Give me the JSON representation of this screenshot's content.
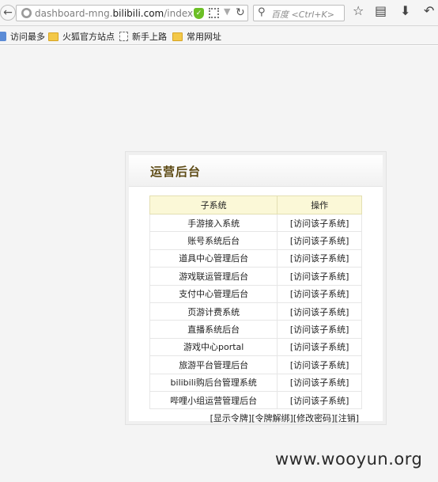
{
  "browser": {
    "url_prefix": "dashboard-mng.",
    "url_host": "bilibili.com",
    "url_path": "/index",
    "search_placeholder": "百度 <Ctrl+K>"
  },
  "bookmarks": [
    {
      "label": "访问最多",
      "icon": "system-folder-icon"
    },
    {
      "label": "火狐官方站点",
      "icon": "folder-icon"
    },
    {
      "label": "新手上路",
      "icon": "page-icon"
    },
    {
      "label": "常用网址",
      "icon": "folder-icon"
    }
  ],
  "panel": {
    "title": "运营后台",
    "table": {
      "headers": [
        "子系统",
        "操作"
      ],
      "rows": [
        {
          "name": "手游接入系统",
          "action": "[访问该子系统]"
        },
        {
          "name": "账号系统后台",
          "action": "[访问该子系统]"
        },
        {
          "name": "道具中心管理后台",
          "action": "[访问该子系统]"
        },
        {
          "name": "游戏联运管理后台",
          "action": "[访问该子系统]"
        },
        {
          "name": "支付中心管理后台",
          "action": "[访问该子系统]"
        },
        {
          "name": "页游计费系统",
          "action": "[访问该子系统]"
        },
        {
          "name": "直播系统后台",
          "action": "[访问该子系统]"
        },
        {
          "name": "游戏中心portal",
          "action": "[访问该子系统]"
        },
        {
          "name": "旅游平台管理后台",
          "action": "[访问该子系统]"
        },
        {
          "name": "bilibili购后台管理系统",
          "action": "[访问该子系统]"
        },
        {
          "name": "哔哩小组运营管理后台",
          "action": "[访问该子系统]"
        }
      ]
    },
    "footer_links": [
      "[显示令牌]",
      "[令牌解绑]",
      "[修改密码]",
      "[注销]"
    ]
  },
  "watermark": "www.wooyun.org"
}
